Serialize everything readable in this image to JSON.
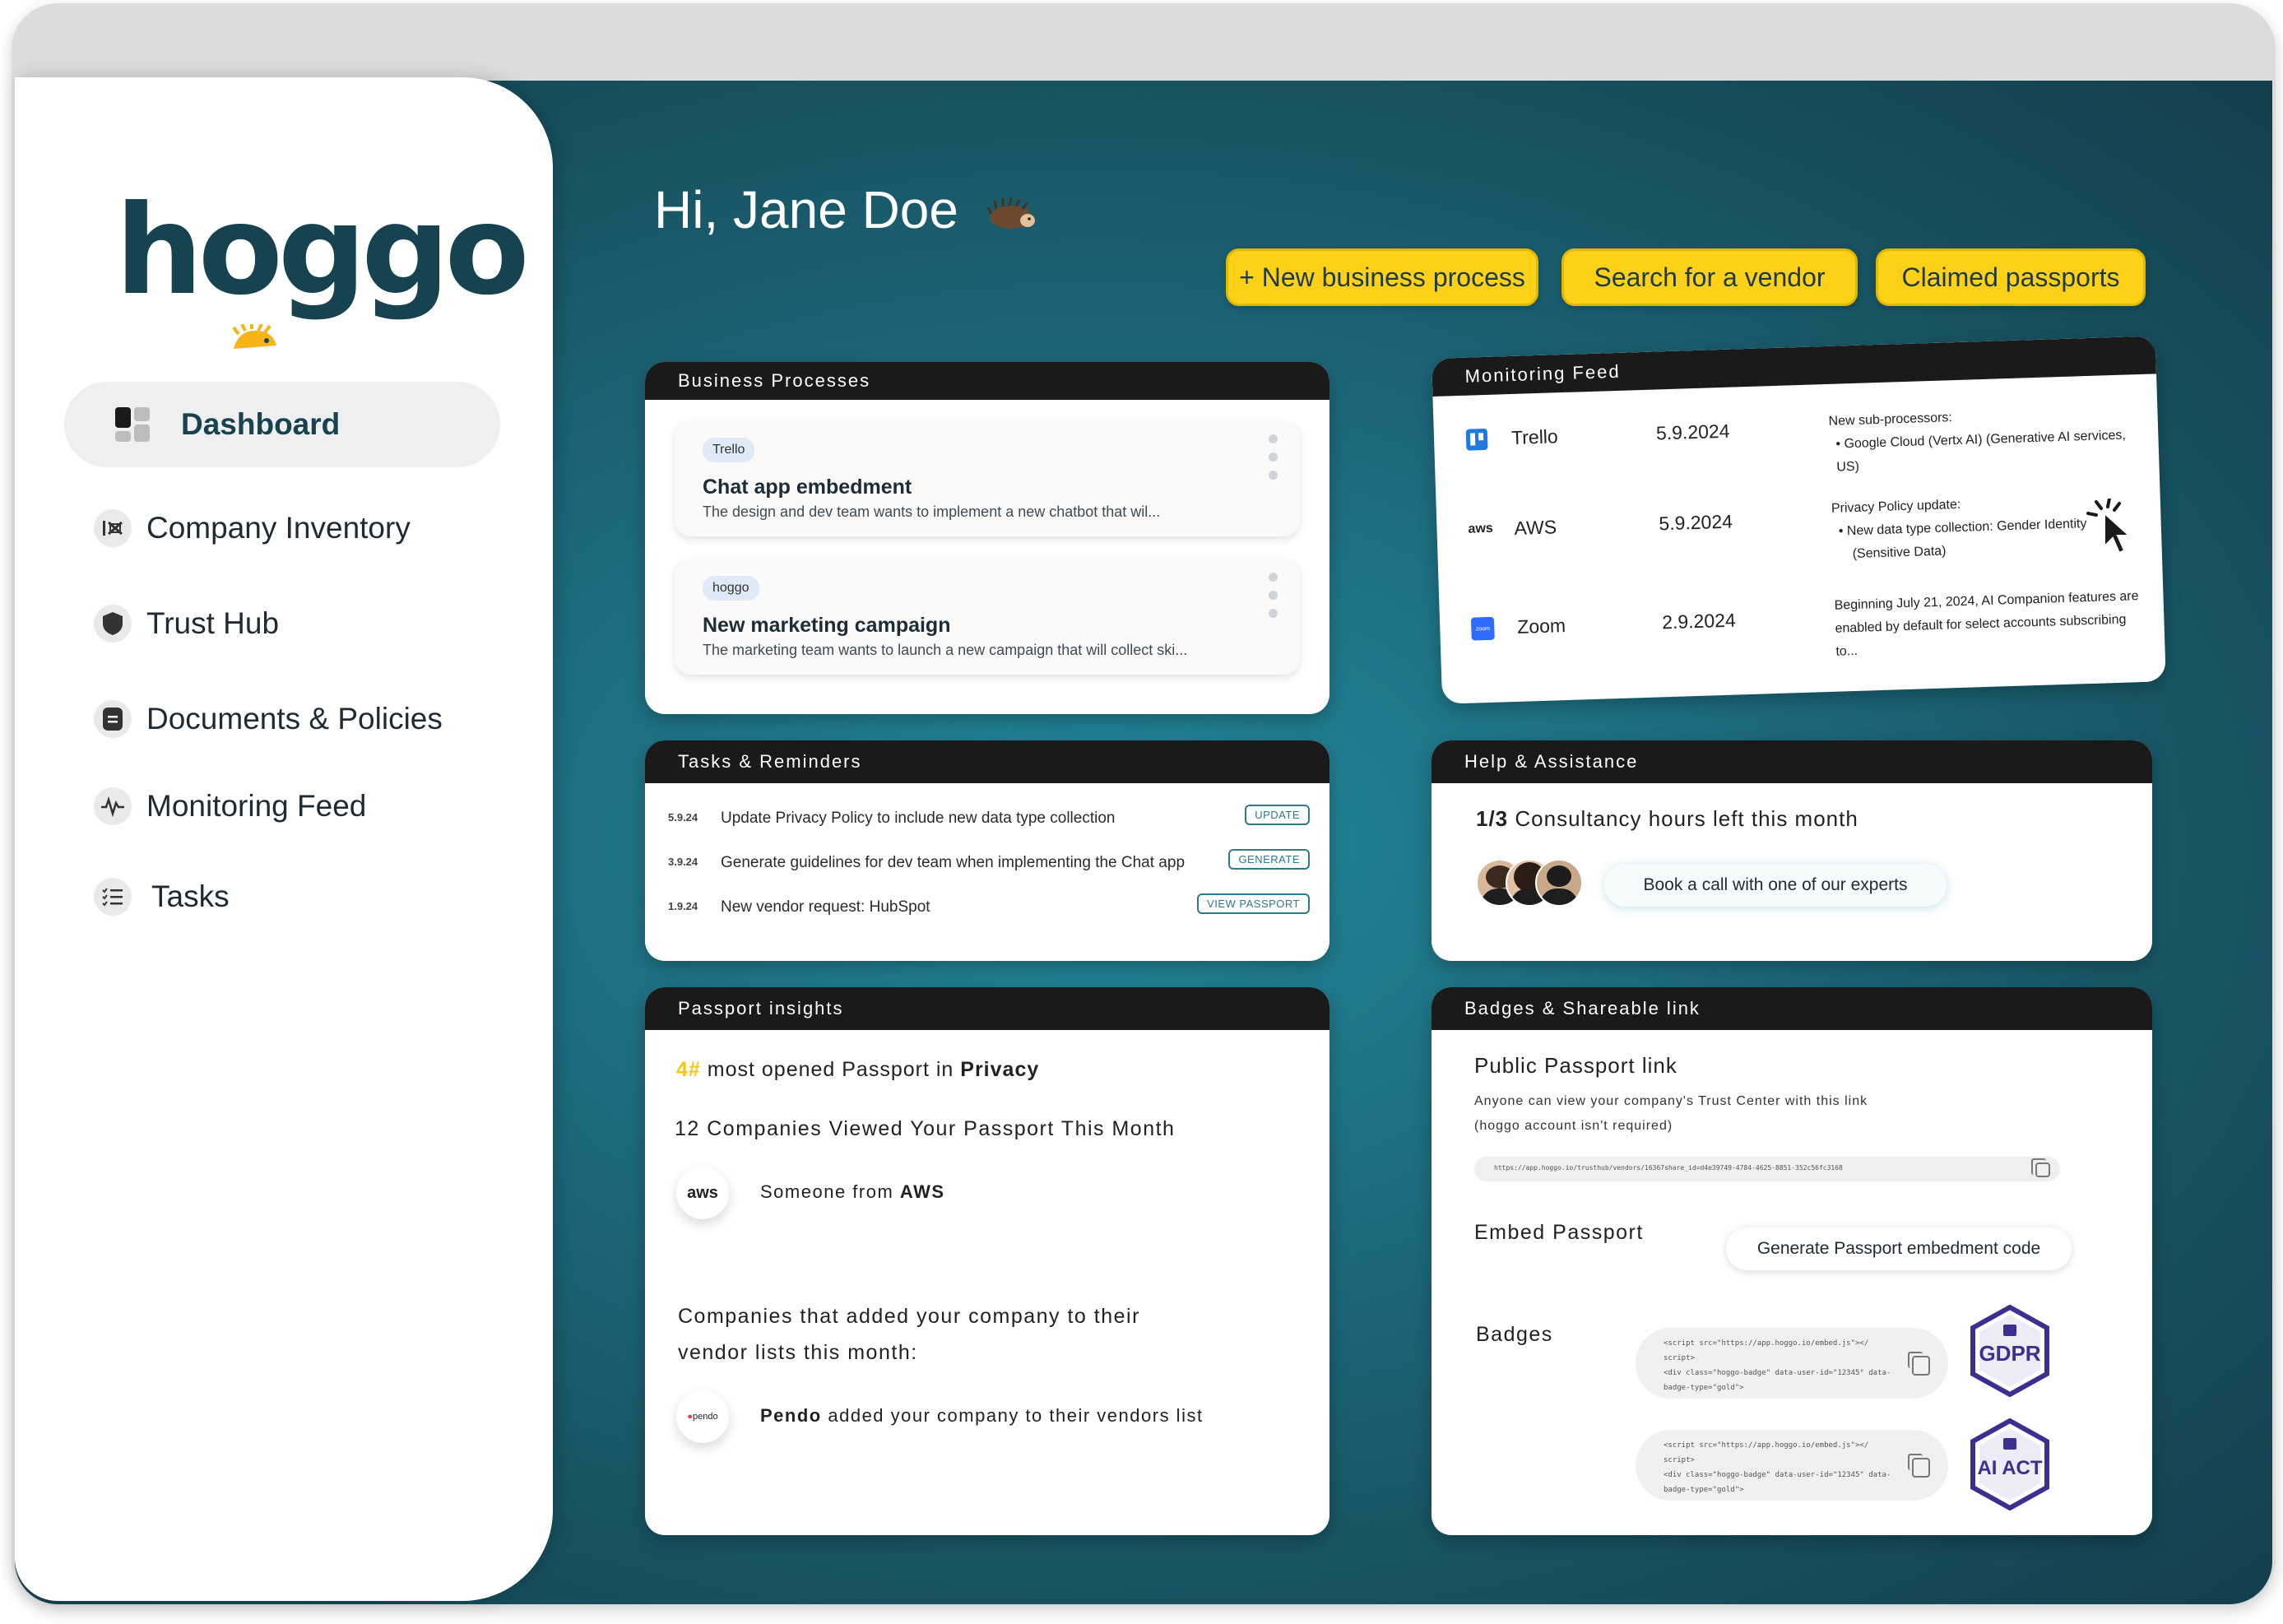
{
  "sidebar": {
    "logo": "hoggo",
    "items": [
      {
        "label": "Dashboard",
        "icon": "dashboard-icon",
        "active": true
      },
      {
        "label": "Company Inventory",
        "icon": "inventory-icon"
      },
      {
        "label": "Trust Hub",
        "icon": "shield-icon"
      },
      {
        "label": "Documents & Policies",
        "icon": "document-icon"
      },
      {
        "label": "Monitoring Feed",
        "icon": "pulse-icon"
      },
      {
        "label": "Tasks",
        "icon": "checklist-icon"
      }
    ]
  },
  "header": {
    "greeting": "Hi, Jane Doe",
    "buttons": {
      "new_process": "+ New business process",
      "search_vendor": "Search for a vendor",
      "claimed": "Claimed passports"
    }
  },
  "business_processes": {
    "title": "Business Processes",
    "items": [
      {
        "tag": "Trello",
        "title": "Chat app embedment",
        "desc": "The design and dev team wants to implement a new chatbot that wil..."
      },
      {
        "tag": "hoggo",
        "title": "New marketing campaign",
        "desc": "The marketing team wants to launch a new campaign that will collect ski..."
      }
    ]
  },
  "monitoring_feed": {
    "title": "Monitoring Feed",
    "rows": [
      {
        "name": "Trello",
        "date": "5.9.2024",
        "line1": "New sub-processors:",
        "line2": "• Google Cloud (Vertx AI) (Generative AI services, US)",
        "line3": ""
      },
      {
        "name": "AWS",
        "date": "5.9.2024",
        "line1": "Privacy Policy update:",
        "line2": "• New data type collection: Gender Identity",
        "line3": "(Sensitive Data)"
      },
      {
        "name": "Zoom",
        "date": "2.9.2024",
        "line1": "Beginning July 21, 2024, AI Companion features are",
        "line2": "enabled by default for select accounts subscribing to...",
        "line3": ""
      }
    ],
    "logo_texts": {
      "aws": "aws",
      "zoom": "zoom"
    }
  },
  "tasks": {
    "title": "Tasks & Reminders",
    "rows": [
      {
        "date": "5.9.24",
        "text": "Update Privacy Policy to include new data type collection",
        "action": "UPDATE"
      },
      {
        "date": "3.9.24",
        "text": "Generate guidelines for dev team when implementing the Chat app",
        "action": "GENERATE"
      },
      {
        "date": "1.9.24",
        "text": "New vendor request: HubSpot",
        "action": "VIEW PASSPORT"
      }
    ]
  },
  "help": {
    "title": "Help & Assistance",
    "hours_count": "1/3",
    "hours_text": "Consultancy hours left this month",
    "book_call": "Book a call with one of our experts"
  },
  "insights": {
    "title": "Passport insights",
    "rank": "4#",
    "rank_mid": "most opened Passport in",
    "rank_category": "Privacy",
    "viewed": "12 Companies Viewed Your Passport This Month",
    "viewer_prefix": "Someone from",
    "viewer_company": "AWS",
    "viewer_logo": "aws",
    "added_line1": "Companies that added your company to their",
    "added_line2": "vendor lists this month:",
    "added_company": "Pendo",
    "added_suffix": "added your company to their vendors list",
    "added_logo": "pendo"
  },
  "badges": {
    "title": "Badges & Shareable link",
    "public_title": "Public Passport link",
    "public_desc1": "Anyone can view your company's Trust Center with this link",
    "public_desc2": "(hoggo account isn't required)",
    "link_url": "https://app.hoggo.io/trusthub/vendors/16367share_id=d4e39749-4784-4625-8851-352c56fc3168",
    "embed_title": "Embed Passport",
    "embed_button": "Generate Passport embedment code",
    "badges_title": "Badges",
    "code_line1": "<script src=\"https://app.hoggo.io/embed.js\"></",
    "code_line2": "script>",
    "code_line3": "<div class=\"hoggo-badge\" data-user-id=\"12345\" data-",
    "code_line4": "badge-type=\"gold\">",
    "gdpr": "GDPR",
    "aiact": "AI ACT",
    "colors": {
      "badge_purple": "#3b2f8f",
      "accent_yellow": "#fcd117"
    }
  }
}
